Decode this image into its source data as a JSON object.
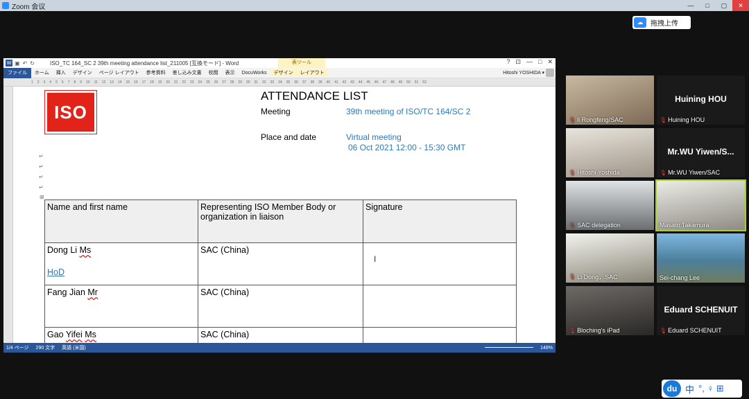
{
  "zoom": {
    "title": "Zoom 会议",
    "upload_label": "拖拽上传",
    "window_controls": [
      "—",
      "□",
      "▢",
      "✕"
    ]
  },
  "word": {
    "doc_title": "ISO_TC 164_SC 2 39th meeting attendance list_211005 [互換モード] - Word",
    "table_tools": "表ツール",
    "title_controls": [
      "?",
      "⊡",
      "—",
      "□",
      "✕"
    ],
    "tabs": [
      "ホーム",
      "挿入",
      "デザイン",
      "ページ レイアウト",
      "参考資料",
      "差し込み文書",
      "校閲",
      "表示",
      "DocuWorks"
    ],
    "context_tabs": [
      "デザイン",
      "レイアウト"
    ],
    "file_tab": "ファイル",
    "user": "Hitoshi YOSHIDA ▾",
    "ruler_numbers": [
      "1",
      "2",
      "3",
      "4",
      "5",
      "6",
      "7",
      "8",
      "9",
      "10",
      "11",
      "12",
      "13",
      "14",
      "15",
      "16",
      "17",
      "18",
      "19",
      "20",
      "21",
      "22",
      "23",
      "24",
      "25",
      "26",
      "27",
      "28",
      "29",
      "30",
      "31",
      "32",
      "33",
      "34",
      "35",
      "36",
      "37",
      "38",
      "39",
      "40",
      "41",
      "42",
      "43",
      "44",
      "45",
      "46",
      "47",
      "48",
      "49",
      "50",
      "51",
      "52"
    ],
    "logo_text": "ISO",
    "heading": "ATTENDANCE LIST",
    "meeting_label": "Meeting",
    "meeting_value": "39th meeting of ISO/TC 164/SC 2",
    "place_label": "Place and date",
    "place_value": "Virtual meeting",
    "date_value": "06 Oct 2021 12:00 - 15:30 GMT",
    "table": {
      "headers": [
        "Name and first name",
        "Representing ISO Member Body or organization in liaison",
        "Signature"
      ],
      "rows": [
        {
          "name": "Dong Li",
          "title": "Ms",
          "org": "SAC (China)",
          "note": "HoD"
        },
        {
          "name": "Fang Jian",
          "title": "Mr",
          "org": "SAC (China)",
          "note": ""
        },
        {
          "name": "Gao",
          "given": "Yifei",
          "title": "Ms",
          "org": "SAC (China)",
          "note": ""
        }
      ]
    },
    "status": {
      "page": "1/4 ページ",
      "words": "290 文字",
      "lang": "英語 (米国)",
      "zoom": "148%"
    }
  },
  "participants": [
    {
      "name": "li Rongfeng/SAC",
      "muted": true,
      "video": true
    },
    {
      "name": "Huining HOU",
      "muted": true,
      "video": false,
      "big_name": "Huining HOU"
    },
    {
      "name": "Hitoshi Yoshida",
      "muted": true,
      "video": true
    },
    {
      "name": "Mr.WU Yiwen/SAC",
      "muted": true,
      "video": false,
      "big_name": "Mr.WU  Yiwen/S..."
    },
    {
      "name": "SAC delegation",
      "muted": true,
      "video": true
    },
    {
      "name": "Masato Takamura",
      "muted": false,
      "video": true,
      "active": true
    },
    {
      "name": "Li Dong，SAC",
      "muted": true,
      "video": true
    },
    {
      "name": "Sei-chang Lee",
      "muted": false,
      "video": true
    },
    {
      "name": "Bloching's iPad",
      "muted": true,
      "video": true
    },
    {
      "name": "Eduard SCHENUIT",
      "muted": true,
      "video": false,
      "big_name": "Eduard SCHENUIT"
    }
  ],
  "tray": {
    "logo": "du",
    "ime": "中",
    "icons": "°,  ♀  ⊞"
  }
}
